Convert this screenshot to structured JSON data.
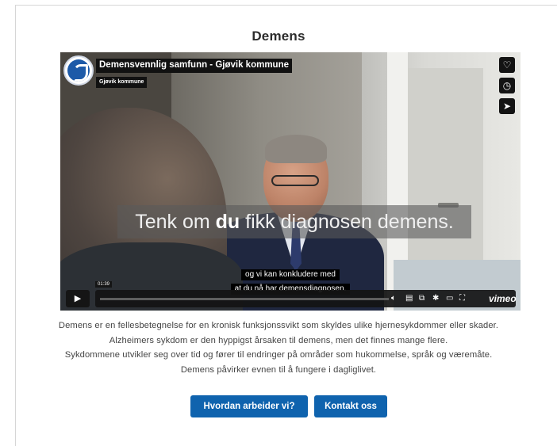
{
  "section": {
    "title": "Demens"
  },
  "video": {
    "title": "Demensvennlig samfunn - Gjøvik kommune",
    "channel": "Gjøvik kommune",
    "caption_before": "Tenk om ",
    "caption_bold": "du",
    "caption_after": " fikk diagnosen demens.",
    "subtitle_line1": "og vi kan konkludere med",
    "subtitle_line2": "at du nå har demensdiagnosen.",
    "time": "01:39",
    "progress": 0.0,
    "brand": "vimeo",
    "side_icons": [
      "heart-icon",
      "clock-icon",
      "send-icon"
    ],
    "control_icons": [
      "volume-icon",
      "captions-icon",
      "pip-icon",
      "settings-icon",
      "airplay-icon",
      "fullscreen-icon"
    ]
  },
  "description": {
    "lines": [
      "Demens er en fellesbetegnelse for en kronisk funksjonssvikt som skyldes ulike hjernesykdommer eller skader.",
      "Alzheimers sykdom er den hyppigst årsaken til demens, men det finnes mange flere.",
      "Sykdommene utvikler seg over tid og fører til endringer på områder som hukommelse, språk og væremåte.",
      "Demens påvirker evnen til å fungere i dagliglivet."
    ]
  },
  "buttons": {
    "primary": "Hvordan arbeider vi?",
    "contact": "Kontakt oss"
  },
  "colors": {
    "button": "#0f63ae",
    "video_overlay": "#111111"
  }
}
